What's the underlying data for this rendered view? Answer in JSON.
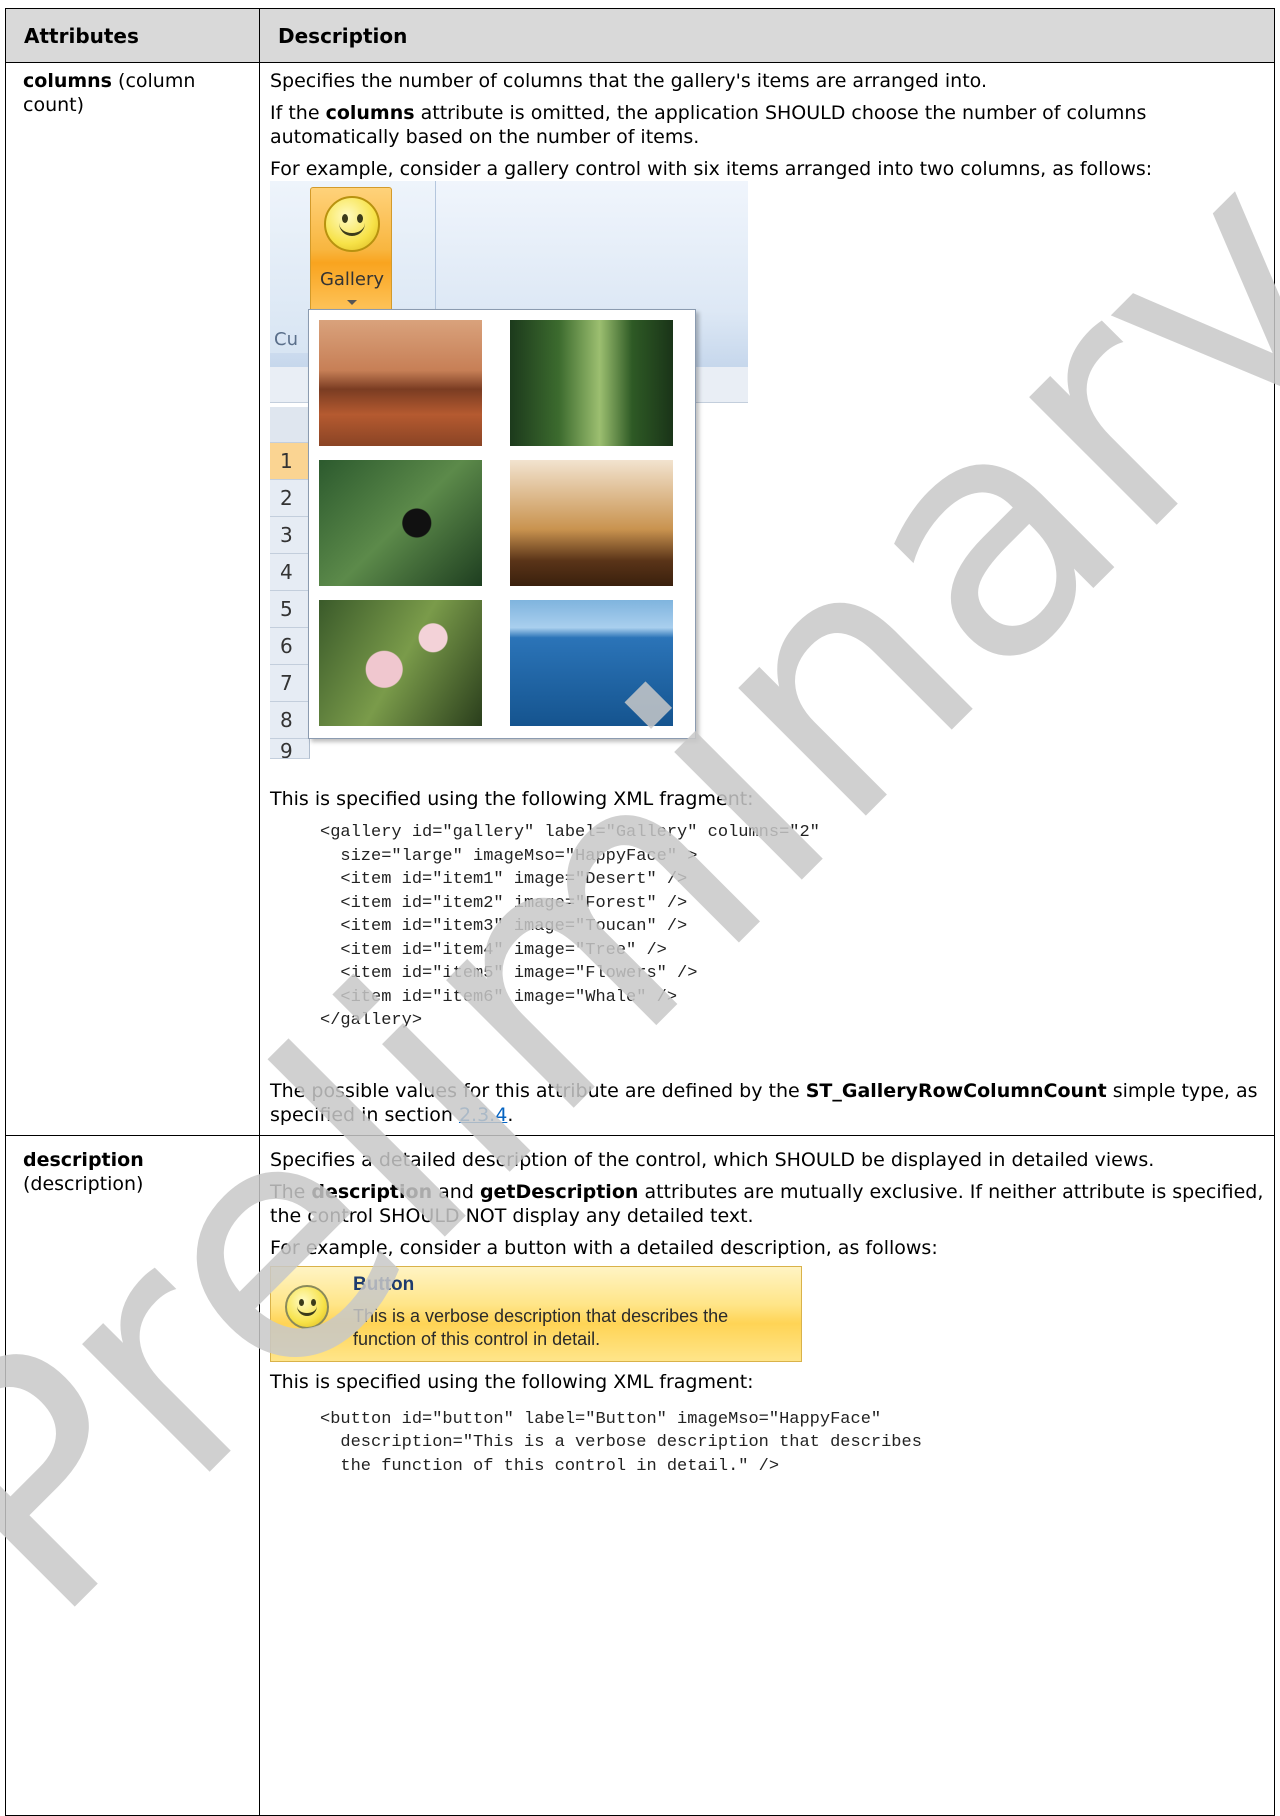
{
  "table": {
    "headers": {
      "attributes": "Attributes",
      "description": "Description"
    },
    "rows": [
      {
        "attr_name": "columns",
        "attr_sub": "(column count)",
        "p1": "Specifies the number of columns that the gallery's items are arranged into.",
        "p2_pre": "If the ",
        "p2_bold": "columns",
        "p2_post": " attribute is omitted, the application SHOULD choose the number of columns automatically based on the number of items.",
        "p3": "For example, consider a gallery control with six items arranged into two columns, as follows:",
        "figure": {
          "button_label": "Gallery",
          "group_label": "Cu",
          "row_numbers": [
            "1",
            "2",
            "3",
            "4",
            "5",
            "6",
            "7",
            "8",
            "9"
          ],
          "thumbnails": [
            "Desert",
            "Forest",
            "Toucan",
            "Tree",
            "Flowers",
            "Whale"
          ]
        },
        "p4": "This is specified using the following XML fragment:",
        "code": "<gallery id=\"gallery\" label=\"Gallery\" columns=\"2\"\n  size=\"large\" imageMso=\"HappyFace\" >\n  <item id=\"item1\" image=\"Desert\" />\n  <item id=\"item2\" image=\"Forest\" />\n  <item id=\"item3\" image=\"Toucan\" />\n  <item id=\"item4\" image=\"Tree\" />\n  <item id=\"item5\" image=\"Flowers\" />\n  <item id=\"item6\" image=\"Whale\" />\n</gallery>",
        "p5_pre": "The possible values for this attribute are defined by the ",
        "p5_bold": "ST_GalleryRowColumnCount",
        "p5_mid": " simple type, as specified in section ",
        "p5_link": "2.3.4",
        "p5_post": "."
      },
      {
        "attr_name": "description",
        "attr_sub": "(description)",
        "p1": "Specifies a detailed description of the control, which SHOULD be displayed in detailed views.",
        "p2_pre": "The ",
        "p2_bold1": "description",
        "p2_mid": " and ",
        "p2_bold2": "getDescription",
        "p2_post": " attributes are mutually exclusive. If neither attribute is specified, the control SHOULD NOT display any detailed text.",
        "p3": "For example, consider a button with a detailed description, as follows:",
        "figure": {
          "title": "Button",
          "desc": "This is a verbose description that describes the function of this control in detail."
        },
        "p4": "This is specified using the following XML fragment:",
        "code": "<button id=\"button\" label=\"Button\" imageMso=\"HappyFace\"\n  description=\"This is a verbose description that describes\n  the function of this control in detail.\" />"
      }
    ]
  },
  "watermark": {
    "text": "Preliminary",
    "color": "#c8c8c8"
  }
}
